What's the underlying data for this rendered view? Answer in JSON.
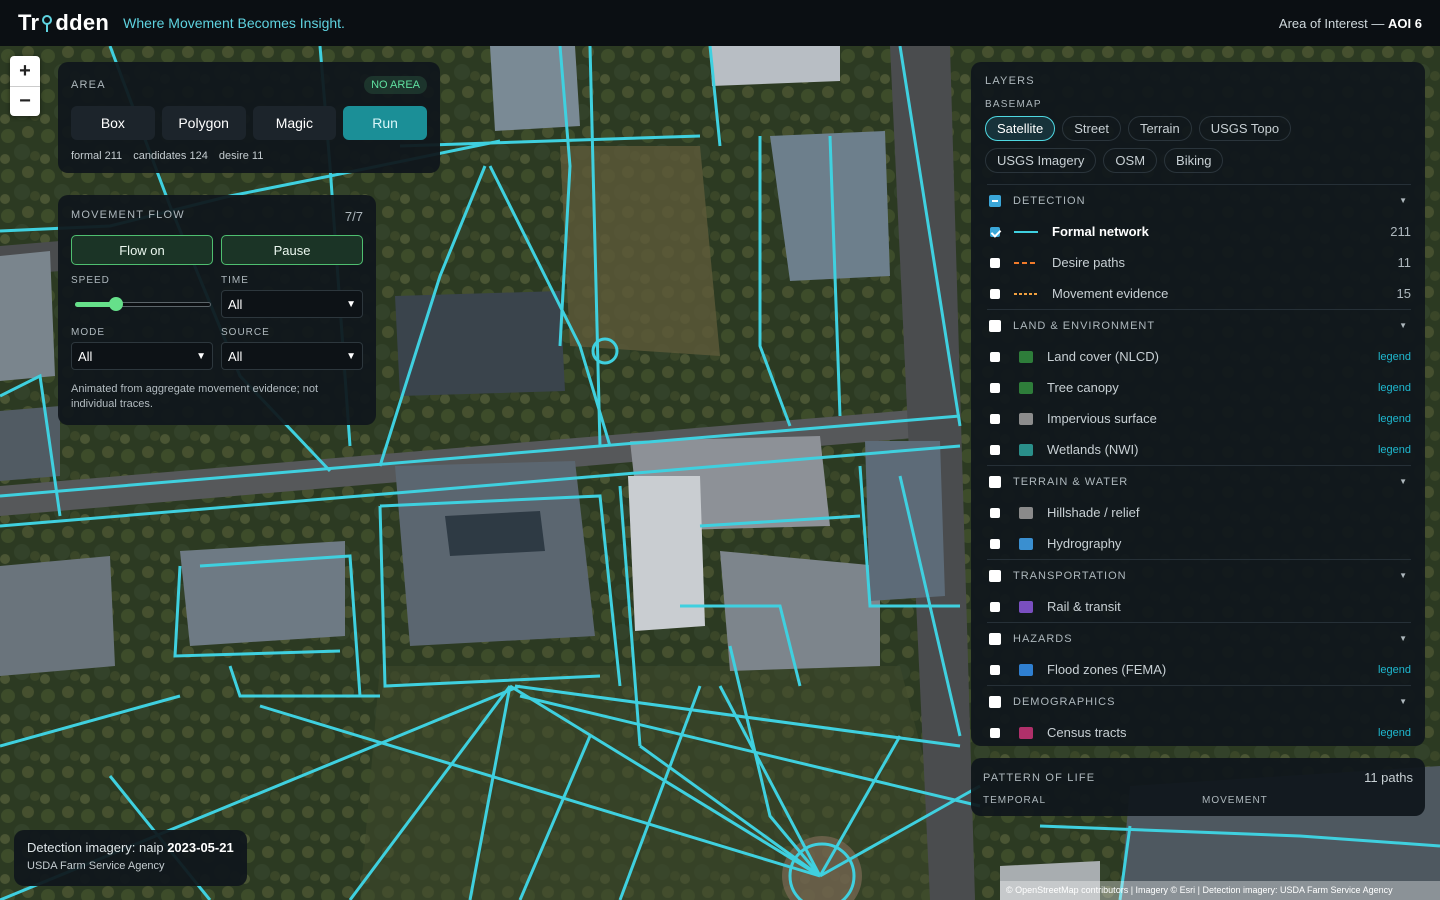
{
  "header": {
    "logo_left": "Tr",
    "logo_right": "dden",
    "tagline": "Where Movement Becomes Insight.",
    "aoi_prefix": "Area of Interest —",
    "aoi_value": "AOI 6"
  },
  "zoom": {
    "in": "+",
    "out": "−"
  },
  "area": {
    "title": "AREA",
    "badge": "NO AREA",
    "buttons": [
      "Box",
      "Polygon",
      "Magic",
      "Run"
    ],
    "stats": {
      "formal": "formal 211",
      "candidates": "candidates 124",
      "desire": "desire 11"
    }
  },
  "flow": {
    "title": "MOVEMENT FLOW",
    "count": "7/7",
    "flow_btn": "Flow on",
    "pause_btn": "Pause",
    "speed_label": "SPEED",
    "speed_value": 0.3,
    "time_label": "TIME",
    "time_value": "All",
    "mode_label": "MODE",
    "mode_value": "All",
    "source_label": "SOURCE",
    "source_value": "All",
    "note": "Animated from aggregate movement evidence; not individual traces."
  },
  "layers": {
    "title": "LAYERS",
    "basemap_label": "BASEMAP",
    "basemaps": [
      "Satellite",
      "Street",
      "Terrain",
      "USGS Topo",
      "USGS Imagery",
      "OSM",
      "Biking"
    ],
    "groups": {
      "detection": {
        "name": "DETECTION",
        "items": [
          {
            "name": "Formal network",
            "count": "211",
            "color": "#3fd0df"
          },
          {
            "name": "Desire paths",
            "count": "11",
            "color": "#f07a2a"
          },
          {
            "name": "Movement evidence",
            "count": "15",
            "color": "#f0a040"
          }
        ]
      },
      "land": {
        "name": "LAND & ENVIRONMENT",
        "items": [
          {
            "name": "Land cover (NLCD)",
            "legend": "legend",
            "color": "#2e7d3a"
          },
          {
            "name": "Tree canopy",
            "legend": "legend",
            "color": "#2e7d3a"
          },
          {
            "name": "Impervious surface",
            "legend": "legend",
            "color": "#8c8c8c"
          },
          {
            "name": "Wetlands (NWI)",
            "legend": "legend",
            "color": "#2a8f8a"
          }
        ]
      },
      "terrain": {
        "name": "TERRAIN & WATER",
        "items": [
          {
            "name": "Hillshade / relief",
            "color": "#8a8a8a"
          },
          {
            "name": "Hydrography",
            "color": "#3a8fd0"
          }
        ]
      },
      "transport": {
        "name": "TRANSPORTATION",
        "items": [
          {
            "name": "Rail & transit",
            "color": "#7a4fc0"
          }
        ]
      },
      "hazards": {
        "name": "HAZARDS",
        "items": [
          {
            "name": "Flood zones (FEMA)",
            "legend": "legend",
            "color": "#2f7fd0"
          }
        ]
      },
      "demographics": {
        "name": "DEMOGRAPHICS",
        "items": [
          {
            "name": "Census tracts",
            "legend": "legend",
            "color": "#b0306a"
          }
        ]
      }
    }
  },
  "pattern": {
    "title": "PATTERN OF LIFE",
    "count": "11 paths",
    "temporal": "TEMPORAL",
    "movement": "MOVEMENT"
  },
  "imagery": {
    "prefix": "Detection imagery: naip",
    "date": "2023-05-21",
    "agency": "USDA Farm Service Agency"
  },
  "attribution": "© OpenStreetMap contributors | Imagery © Esri | Detection imagery: USDA Farm Service Agency",
  "colors": {
    "accent": "#3fd0df",
    "network_line": "#3fd0df",
    "run_button": "#1b8f97",
    "flow_button_border": "#4fbf70"
  }
}
